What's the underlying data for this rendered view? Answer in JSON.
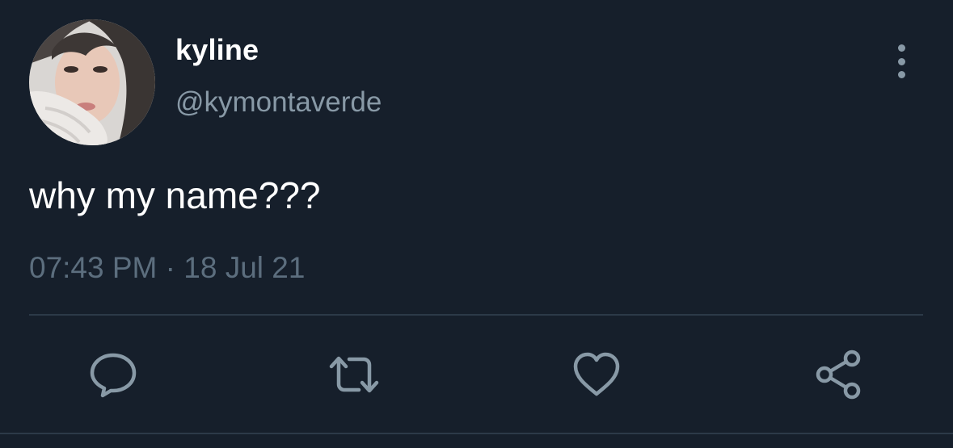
{
  "tweet": {
    "display_name": "kyline",
    "handle": "@kymontaverde",
    "text": "why my name???",
    "time": "07:43 PM",
    "separator": "·",
    "date": "18 Jul 21"
  },
  "icons": {
    "avatar": "profile-photo",
    "more": "more-vertical-icon",
    "reply": "reply-icon",
    "retweet": "retweet-icon",
    "like": "heart-icon",
    "share": "share-icon"
  },
  "colors": {
    "background": "#161f2b",
    "text_primary": "#ffffff",
    "text_secondary": "#8899a6",
    "icon": "#8899a6",
    "divider": "#2c3a48"
  }
}
